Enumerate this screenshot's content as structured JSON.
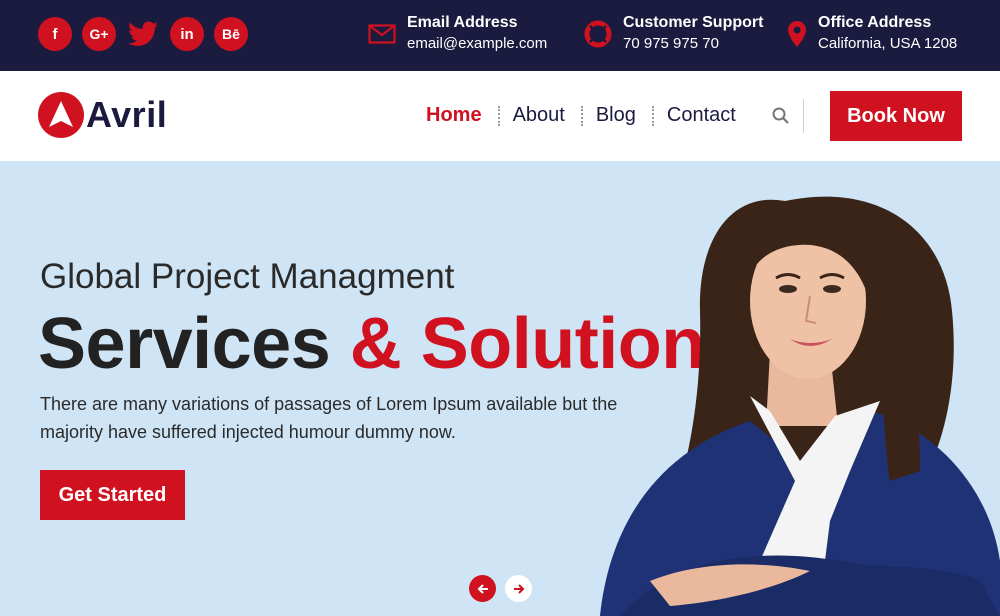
{
  "social": {
    "facebook": "f",
    "google": "G+",
    "linkedin": "in",
    "behance": "Bē"
  },
  "contacts": [
    {
      "title": "Email Address",
      "value": "email@example.com",
      "icon": "envelope-icon"
    },
    {
      "title": "Customer Support",
      "value": "70 975 975 70",
      "icon": "lifebuoy-icon"
    },
    {
      "title": "Office Address",
      "value": "California, USA 1208",
      "icon": "map-pin-icon"
    }
  ],
  "brand": {
    "name": "Avril"
  },
  "nav": {
    "items": [
      "Home",
      "About",
      "Blog",
      "Contact"
    ],
    "active": "Home",
    "book_label": "Book Now"
  },
  "hero": {
    "subtitle": "Global Project Managment",
    "title_main": "Services ",
    "title_accent": "& Solution",
    "description": "There are many variations of passages of Lorem Ipsum available but the majority have suffered injected humour dummy now.",
    "cta_label": "Get Started"
  },
  "colors": {
    "primary": "#d0111f",
    "dark": "#1b1a3f",
    "hero_bg": "#cfe5f5"
  }
}
